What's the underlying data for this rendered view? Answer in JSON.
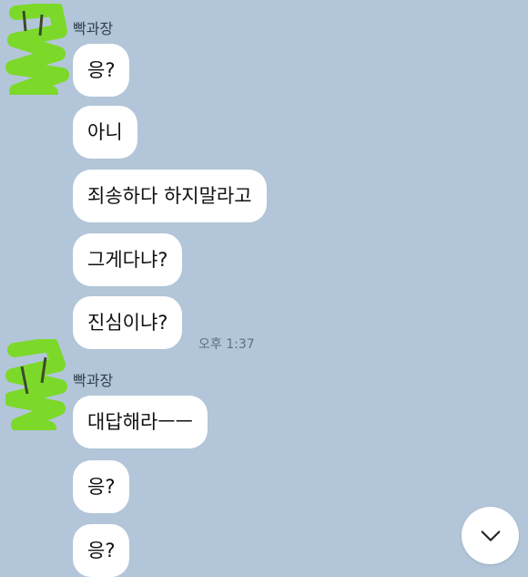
{
  "theme": {
    "background": "#b3c6d9",
    "bubble": "#ffffff",
    "avatar_scribble": "#7cd92a"
  },
  "groups": [
    {
      "sender": "빡과장",
      "messages": [
        "응?",
        "아니",
        "죄송하다 하지말라고",
        "그게다냐?",
        "진심이냐?"
      ],
      "time": "오후 1:37"
    },
    {
      "sender": "빡과장",
      "messages": [
        "대답해라ㅡㅡ",
        "응?",
        "응?"
      ]
    }
  ],
  "scroll_button": {
    "icon": "chevron-down-icon"
  }
}
